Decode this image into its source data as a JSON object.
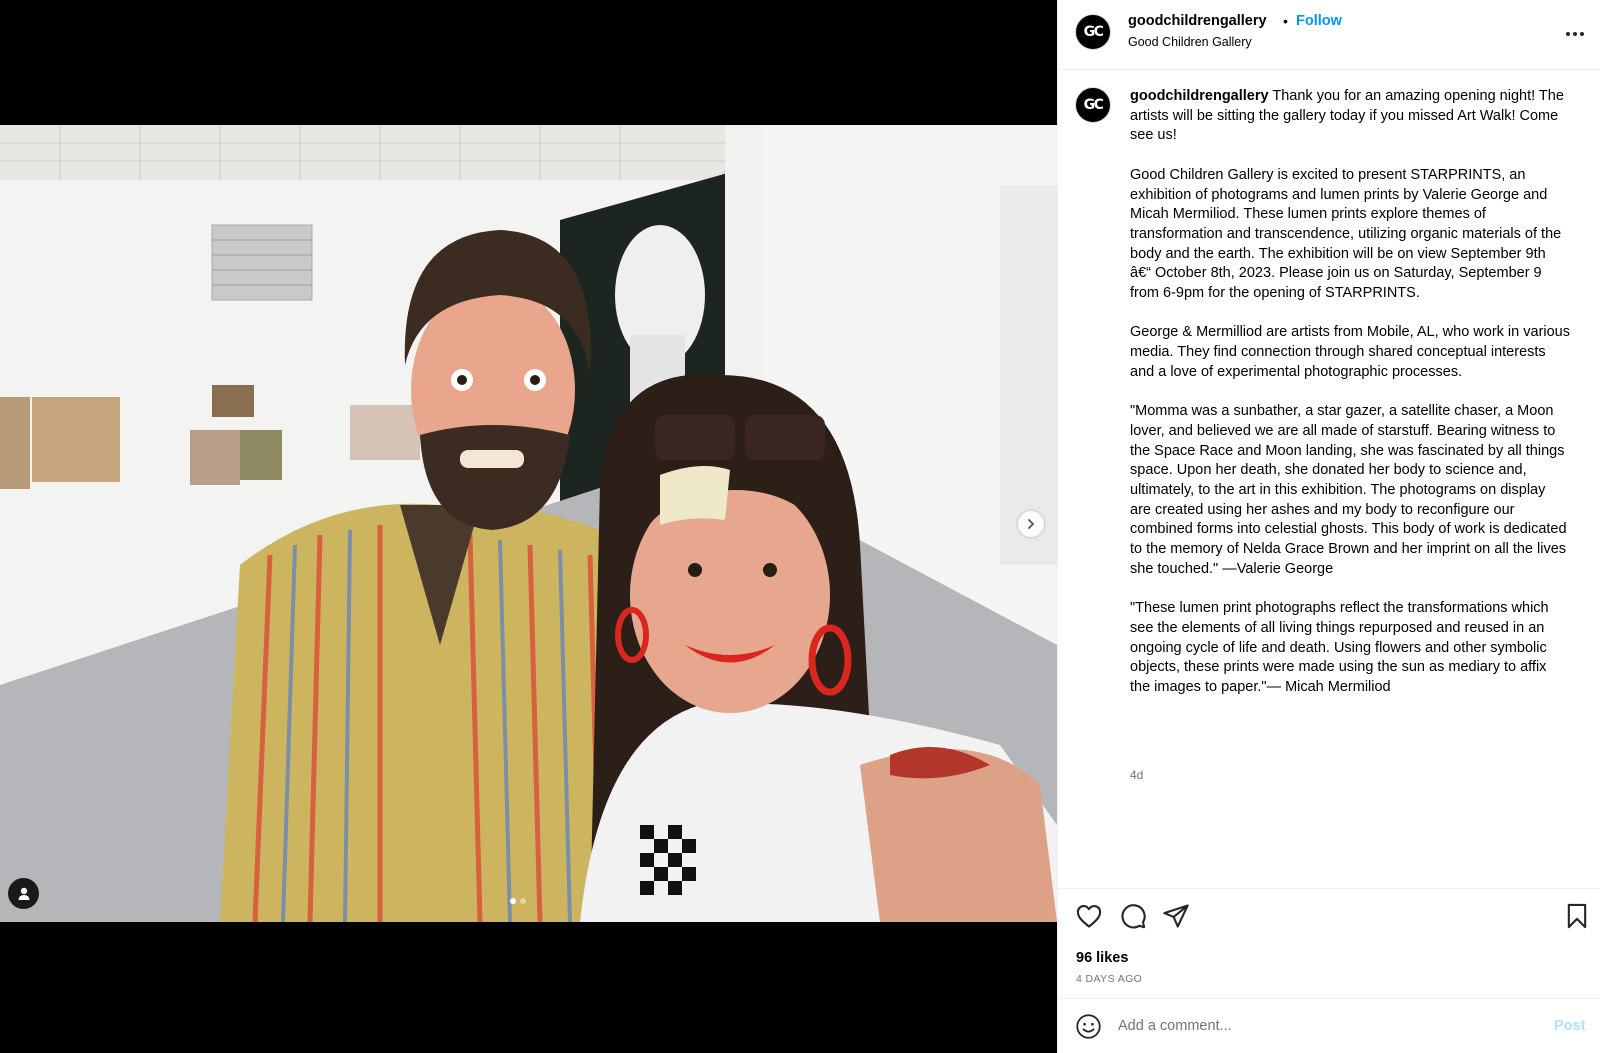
{
  "post": {
    "username": "goodchildrengallery",
    "separator": "•",
    "follow_label": "Follow",
    "location": "Good Children Gallery",
    "avatar_text": "GC",
    "caption_user": "goodchildrengallery",
    "caption_text": " Thank you for an amazing opening night! The artists will be sitting the gallery today if you missed Art Walk! Come see us!\n\nGood Children Gallery is excited to present STARPRINTS, an exhibition of photograms and lumen prints by Valerie George and Micah Mermiliod. These lumen prints explore themes of transformation and transcendence, utilizing organic materials of the body and the earth. The exhibition will be on view September 9th â€“ October 8th, 2023. Please join us on Saturday, September 9 from 6-9pm for the opening of STARPRINTS.\n\nGeorge & Mermilliod are artists from Mobile, AL, who work in various media. They find connection through shared conceptual interests and a love of experimental photographic processes.\n\n\"Momma was a sunbather, a star gazer, a satellite chaser, a Moon lover, and believed we are all made of starstuff. Bearing witness to the Space Race and Moon landing, she was fascinated by all things space. Upon her death, she donated her body to science and, ultimately, to the art in this exhibition. The photograms on display are created using her ashes and my body to reconfigure our combined forms into celestial ghosts. This body of work is dedicated to the memory of Nelda Grace Brown and her imprint on all the lives she touched.\" —Valerie George\n\n\"These lumen print photographs reflect the transformations which see the elements of all living things repurposed and reused in an ongoing cycle of life and death. Using flowers and other symbolic objects, these prints were made using the sun as mediary to affix the images to paper.\"— Micah Mermiliod",
    "caption_time": "4d",
    "likes": "96 likes",
    "posted_ago": "4 DAYS AGO"
  },
  "comment": {
    "placeholder": "Add a comment...",
    "post_label": "Post"
  },
  "media": {
    "carousel_count": 2,
    "carousel_active": 0
  },
  "icons": {
    "more": "more-horizontal-icon",
    "like": "heart-icon",
    "comment": "comment-bubble-icon",
    "share": "paper-plane-icon",
    "save": "bookmark-icon",
    "emoji": "emoji-smile-icon",
    "next": "chevron-right-icon",
    "tag": "user-tag-icon"
  },
  "colors": {
    "follow": "#0095f6",
    "post_disabled": "#b2dffc",
    "muted": "#737373",
    "divider": "#efefef"
  }
}
